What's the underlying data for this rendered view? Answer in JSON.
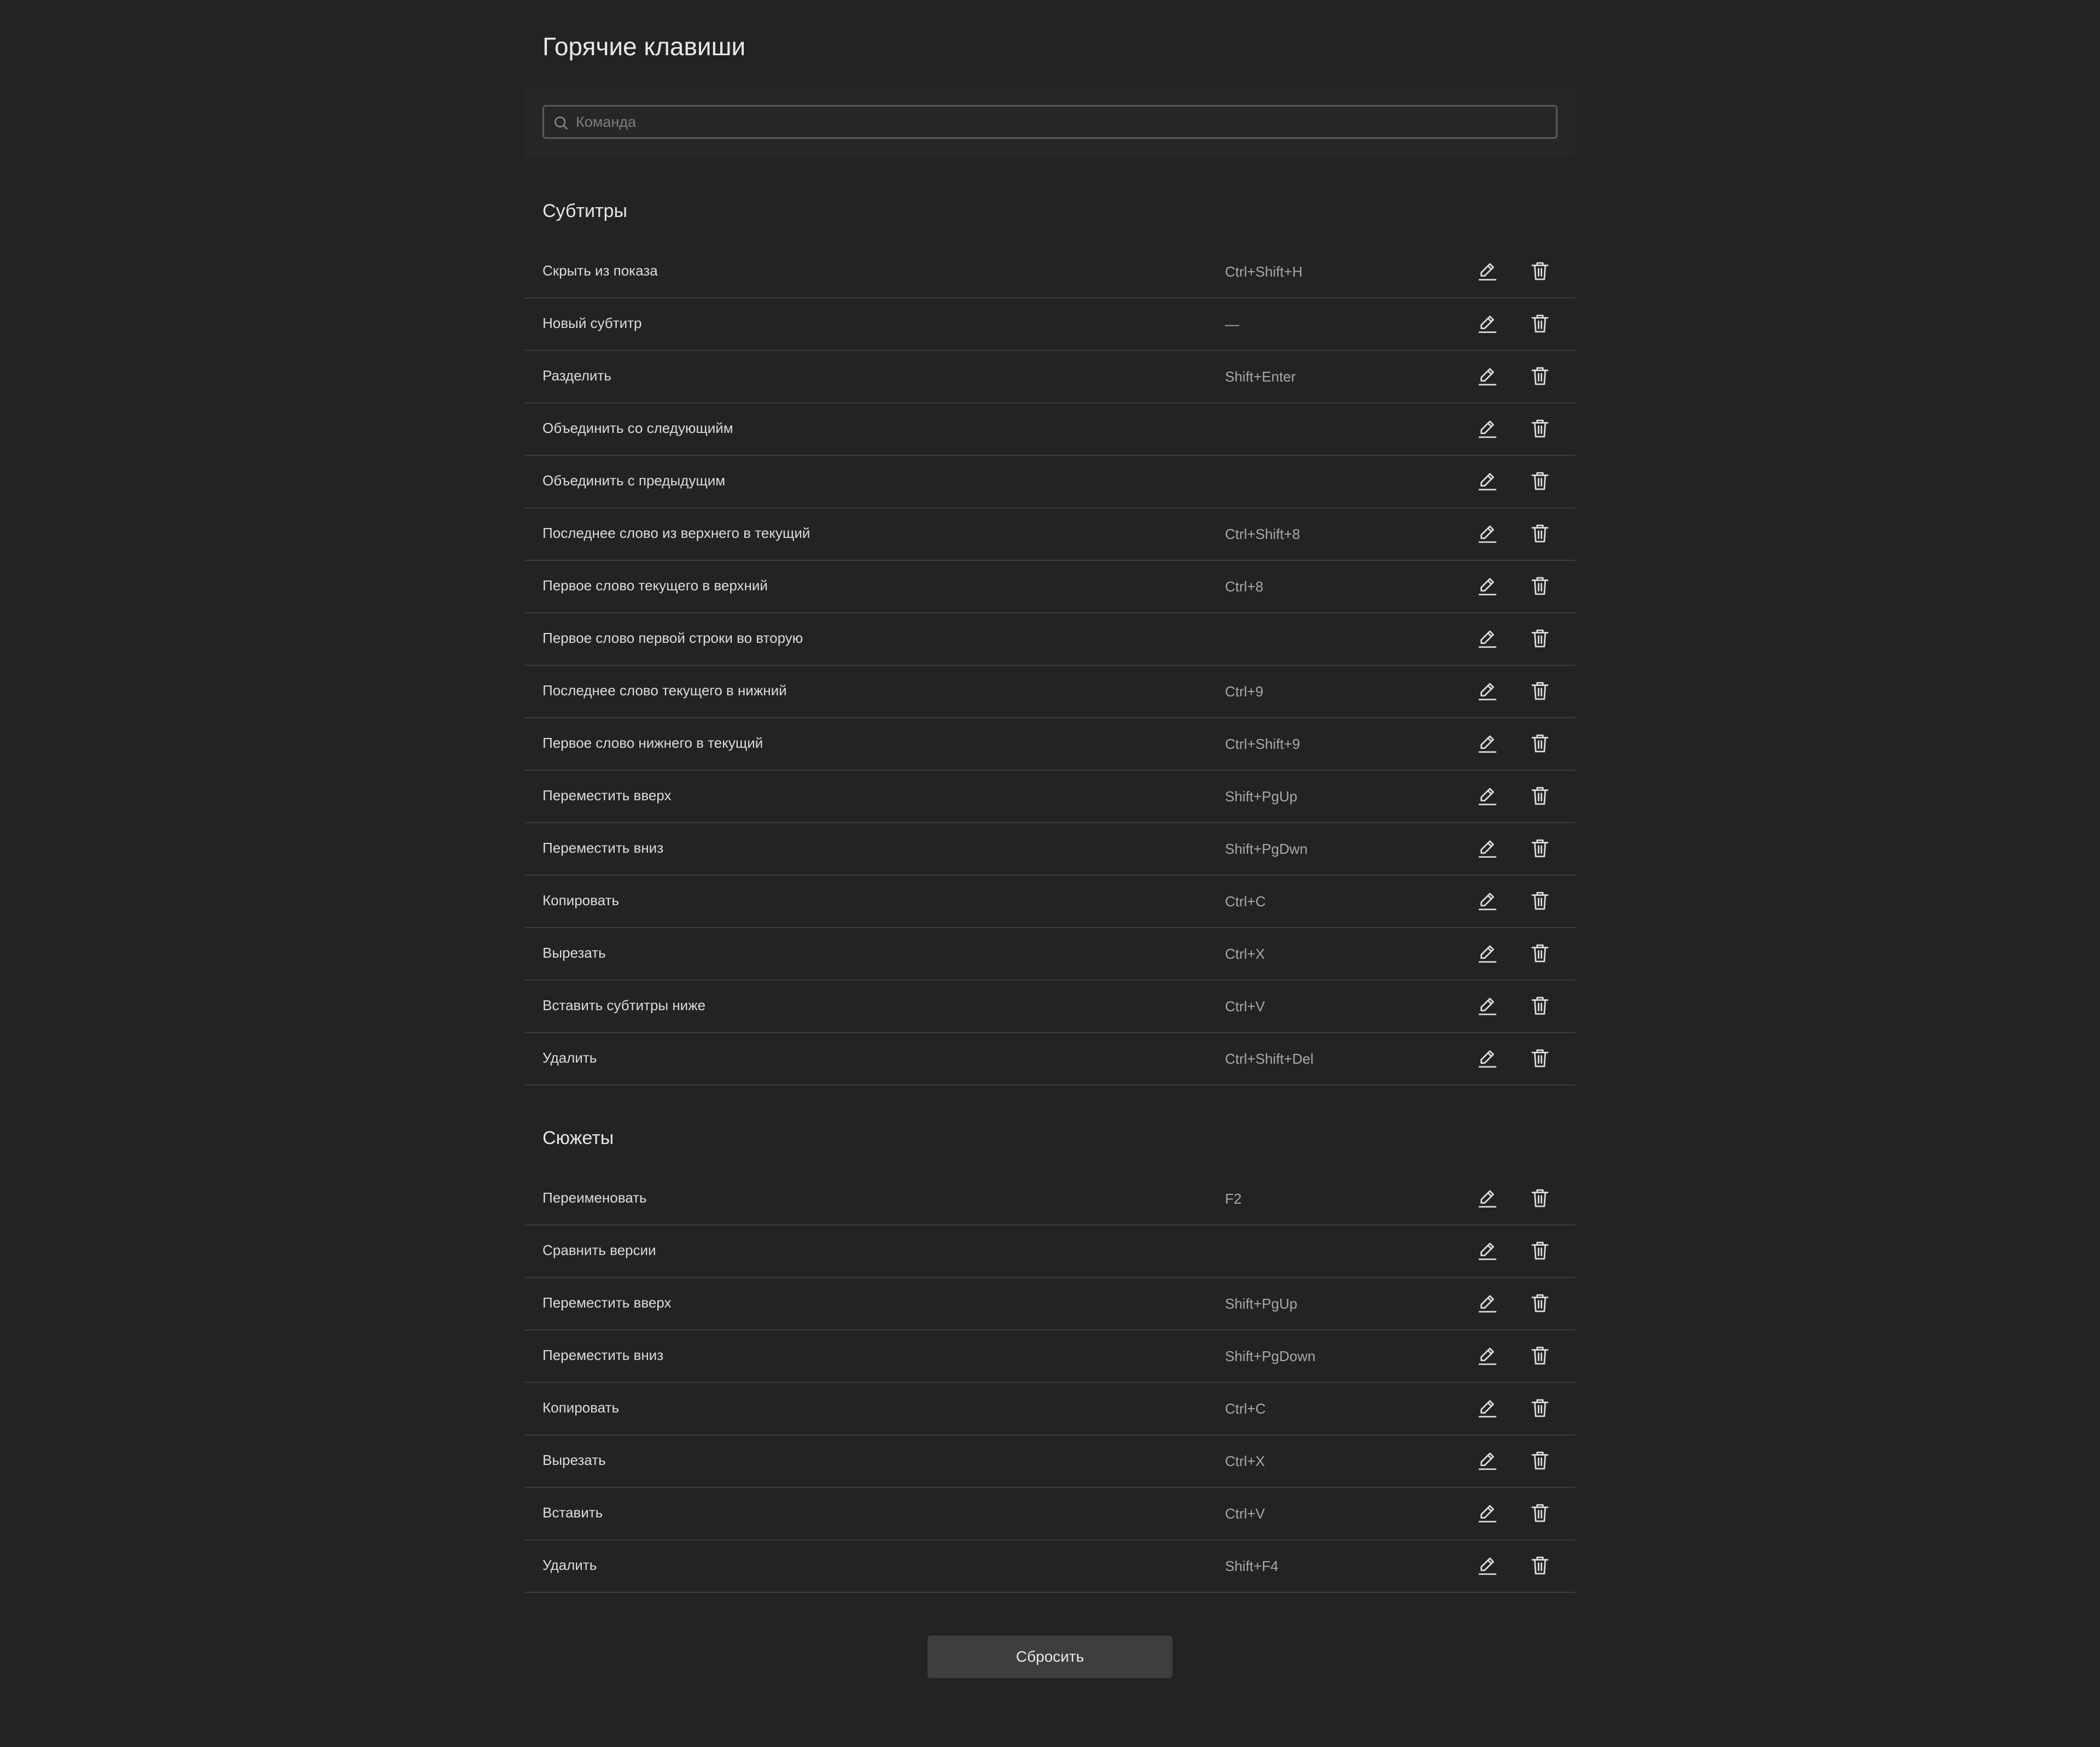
{
  "title": "Горячие клавиши",
  "search": {
    "placeholder": "Команда",
    "value": ""
  },
  "sections": [
    {
      "title": "Субтитры",
      "rows": [
        {
          "label": "Скрыть из показа",
          "shortcut": "Ctrl+Shift+H"
        },
        {
          "label": "Новый субтитр",
          "shortcut": "—"
        },
        {
          "label": "Разделить",
          "shortcut": "Shift+Enter"
        },
        {
          "label": "Объединить со следующийм",
          "shortcut": ""
        },
        {
          "label": "Объединить с предыдущим",
          "shortcut": ""
        },
        {
          "label": "Последнее слово из верхнего в текущий",
          "shortcut": "Ctrl+Shift+8"
        },
        {
          "label": "Первое слово текущего в верхний",
          "shortcut": "Ctrl+8"
        },
        {
          "label": "Первое слово первой строки во вторую",
          "shortcut": ""
        },
        {
          "label": "Последнее слово текущего в нижний",
          "shortcut": "Ctrl+9"
        },
        {
          "label": "Первое слово нижнего в текущий",
          "shortcut": "Ctrl+Shift+9"
        },
        {
          "label": "Переместить вверх",
          "shortcut": "Shift+PgUp"
        },
        {
          "label": "Переместить вниз",
          "shortcut": "Shift+PgDwn"
        },
        {
          "label": "Копировать",
          "shortcut": "Ctrl+C"
        },
        {
          "label": "Вырезать",
          "shortcut": "Ctrl+X"
        },
        {
          "label": "Вставить субтитры ниже",
          "shortcut": "Ctrl+V"
        },
        {
          "label": "Удалить",
          "shortcut": "Ctrl+Shift+Del"
        }
      ]
    },
    {
      "title": "Сюжеты",
      "rows": [
        {
          "label": "Переименовать",
          "shortcut": "F2"
        },
        {
          "label": "Сравнить версии",
          "shortcut": ""
        },
        {
          "label": "Переместить вверх",
          "shortcut": "Shift+PgUp"
        },
        {
          "label": "Переместить вниз",
          "shortcut": "Shift+PgDown"
        },
        {
          "label": "Копировать",
          "shortcut": "Ctrl+C"
        },
        {
          "label": "Вырезать",
          "shortcut": "Ctrl+X"
        },
        {
          "label": "Вставить",
          "shortcut": "Ctrl+V"
        },
        {
          "label": "Удалить",
          "shortcut": "Shift+F4"
        }
      ]
    }
  ],
  "icons": {
    "edit": "pencil-icon",
    "delete": "trash-icon",
    "search": "search-icon"
  },
  "reset_label": "Сбросить"
}
